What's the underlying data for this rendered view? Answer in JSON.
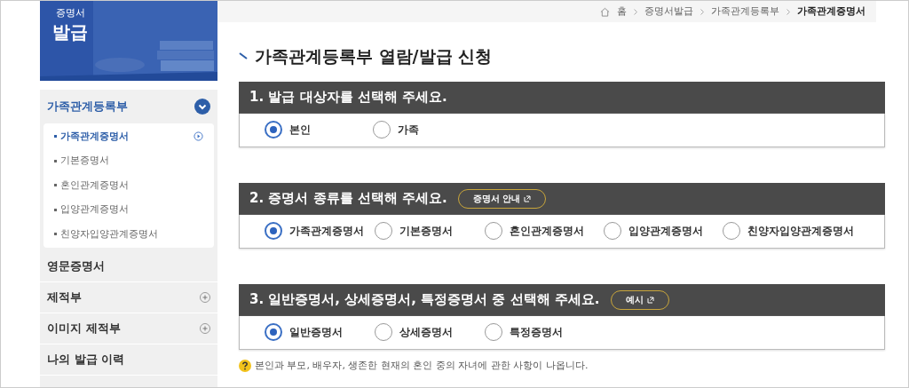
{
  "breadcrumb": [
    {
      "label": "홈",
      "current": false
    },
    {
      "label": "증명서발급",
      "current": false
    },
    {
      "label": "가족관계등록부",
      "current": false
    },
    {
      "label": "가족관계증명서",
      "current": true
    }
  ],
  "banner": {
    "lines": [
      "증명서",
      "발급"
    ]
  },
  "sidebar": {
    "items": [
      {
        "label": "가족관계등록부",
        "kind": "group",
        "expanded": true,
        "children": [
          {
            "label": "가족관계증명서",
            "selected": true
          },
          {
            "label": "기본증명서",
            "selected": false
          },
          {
            "label": "혼인관계증명서",
            "selected": false
          },
          {
            "label": "입양관계증명서",
            "selected": false
          },
          {
            "label": "친양자입양관계증명서",
            "selected": false
          }
        ]
      },
      {
        "label": "영문증명서",
        "kind": "link"
      },
      {
        "label": "제적부",
        "kind": "expandable"
      },
      {
        "label": "이미지 제적부",
        "kind": "expandable"
      },
      {
        "label": "나의 발급 이력",
        "kind": "link"
      }
    ]
  },
  "page_title": "가족관계등록부 열람/발급 신청",
  "sections": [
    {
      "title": "1. 발급 대상자를 선택해 주세요.",
      "options": [
        {
          "label": "본인",
          "selected": true
        },
        {
          "label": "가족",
          "selected": false
        }
      ]
    },
    {
      "title": "2. 증명서 종류를 선택해 주세요.",
      "button": "증명서 안내",
      "options": [
        {
          "label": "가족관계증명서",
          "selected": true
        },
        {
          "label": "기본증명서",
          "selected": false
        },
        {
          "label": "혼인관계증명서",
          "selected": false
        },
        {
          "label": "입양관계증명서",
          "selected": false
        },
        {
          "label": "친양자입양관계증명서",
          "selected": false
        }
      ]
    },
    {
      "title": "3. 일반증명서, 상세증명서, 특정증명서 중 선택해 주세요.",
      "button": "예시",
      "options": [
        {
          "label": "일반증명서",
          "selected": true
        },
        {
          "label": "상세증명서",
          "selected": false
        },
        {
          "label": "특정증명서",
          "selected": false
        }
      ]
    }
  ],
  "note": "본인과 부모, 배우자, 생존한 현재의 혼인 중의 자녀에 관한 사항이 나옵니다."
}
